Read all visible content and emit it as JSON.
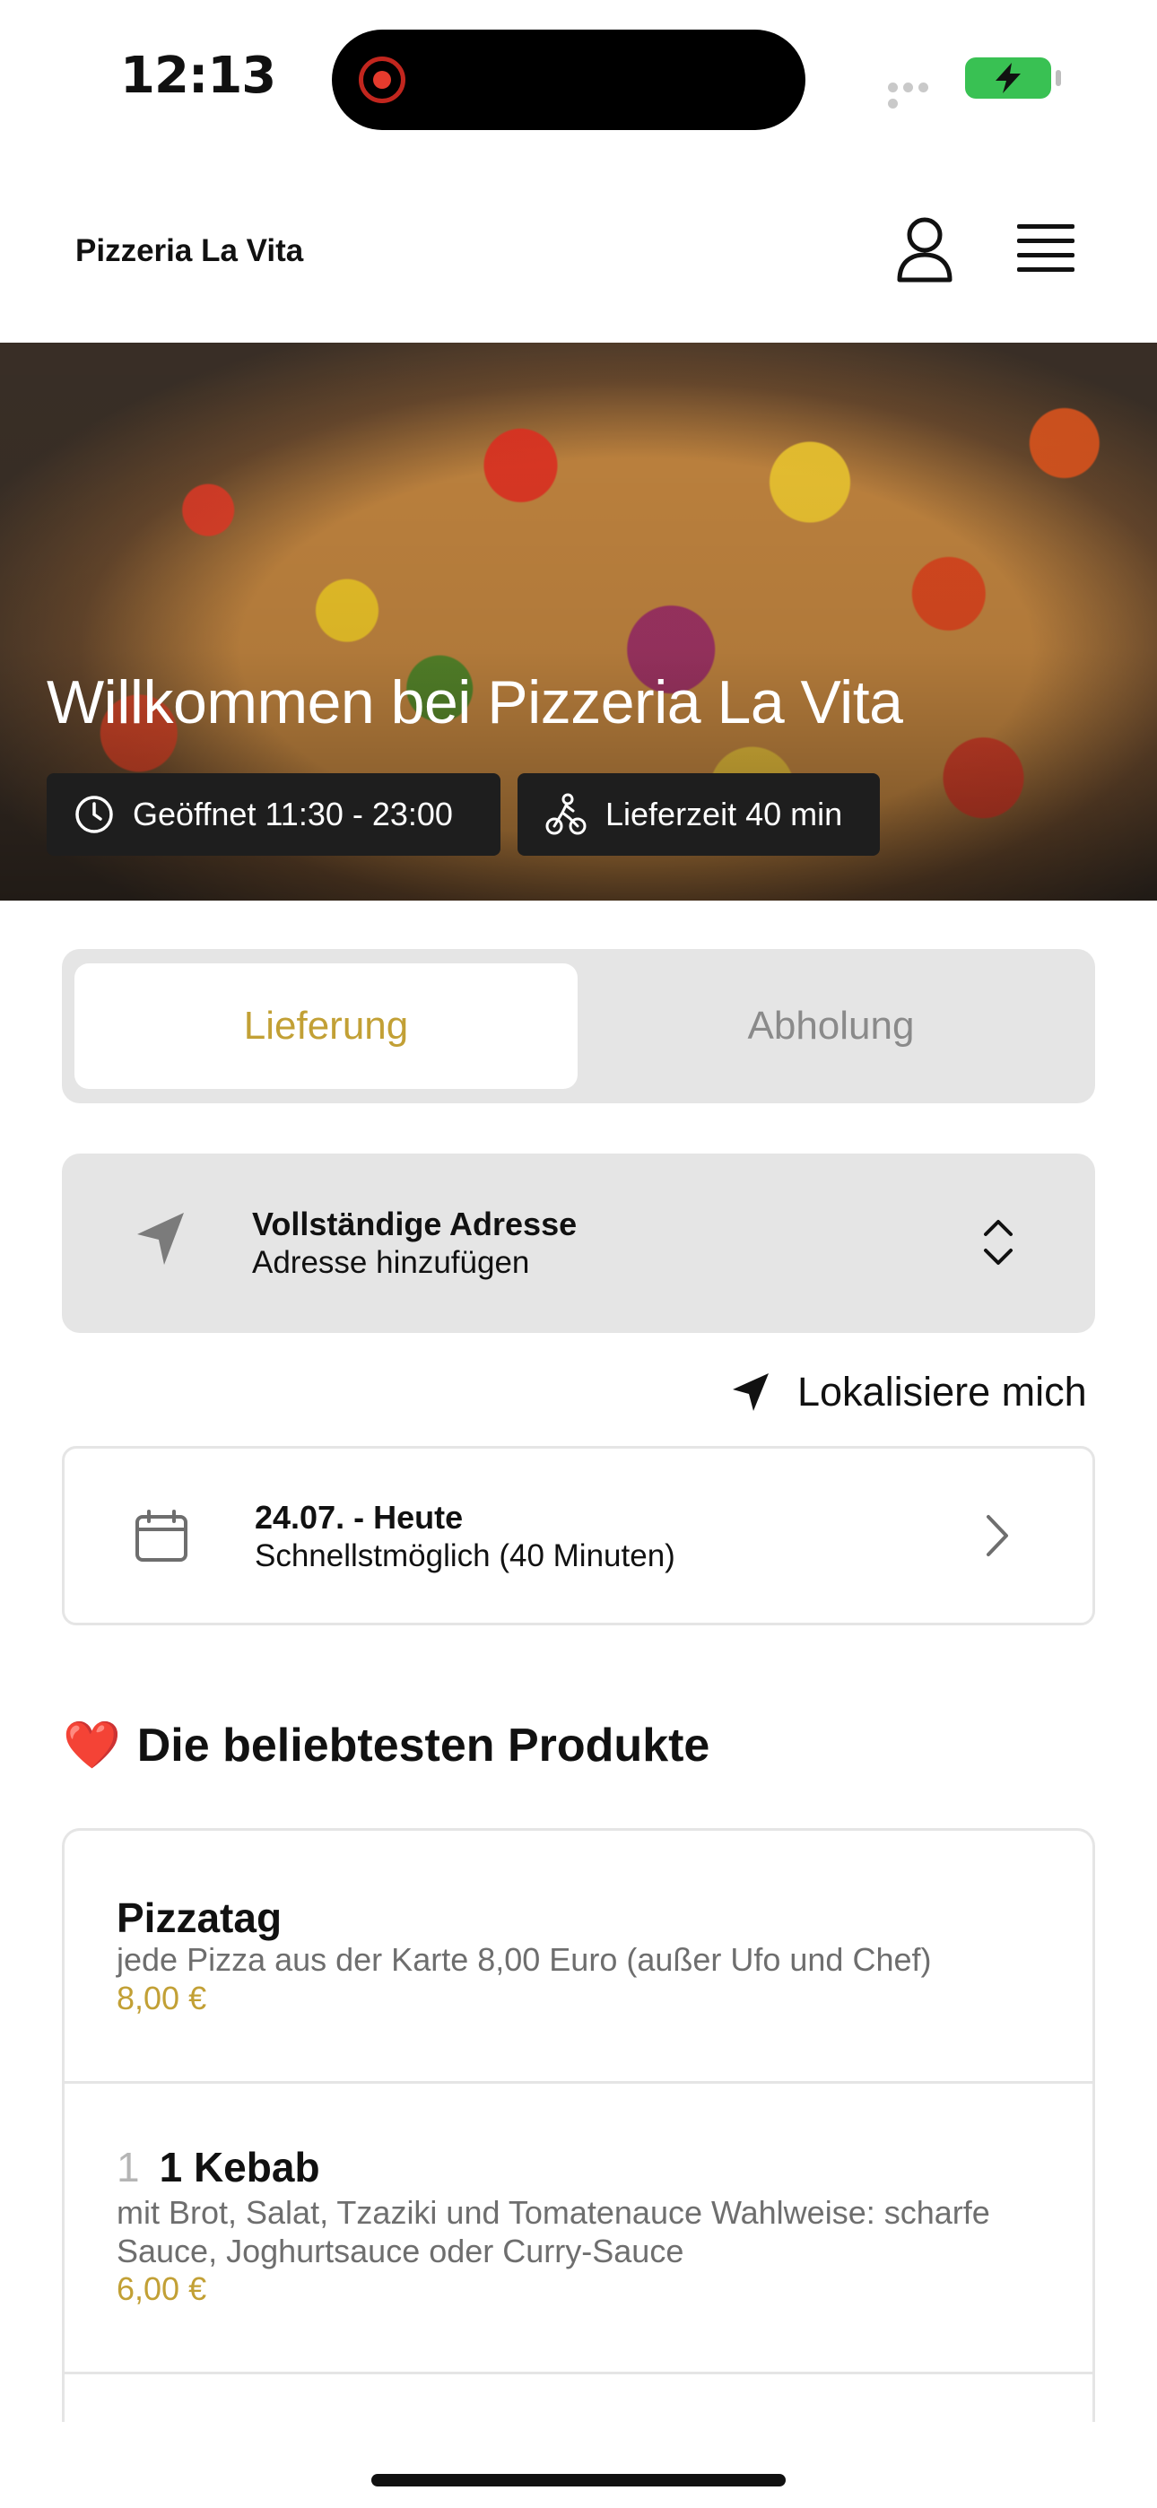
{
  "status_bar": {
    "time": "12:13"
  },
  "header": {
    "title": "Pizzeria La Vita",
    "user_icon": "user-icon",
    "menu_icon": "hamburger-menu-icon"
  },
  "hero": {
    "title": "Willkommen bei Pizzeria La Vita",
    "opening_hours": "Geöffnet 11:30 - 23:00",
    "delivery_time": "Lieferzeit 40 min"
  },
  "mode_toggle": {
    "options": [
      "Lieferung",
      "Abholung"
    ],
    "selected": "Lieferung",
    "accent": "#c2a035"
  },
  "address": {
    "title": "Vollständige Adresse",
    "placeholder": "Adresse hinzufügen"
  },
  "locate": {
    "label": "Lokalisiere mich"
  },
  "date": {
    "title": "24.07. - Heute",
    "subtitle": "Schnellstmöglich (40 Minuten)"
  },
  "popular": {
    "emoji": "❤️",
    "title": "Die beliebtesten Produkte",
    "items": [
      {
        "number": "",
        "name": "Pizzatag",
        "description": "jede Pizza aus der Karte 8,00 Euro (außer Ufo und Chef)",
        "price": "8,00 €"
      },
      {
        "number": "1",
        "name": "1 Kebab",
        "description": "mit Brot, Salat, Tzaziki und Tomatenauce  Wahlweise: scharfe Sauce, Joghurtsauce oder Curry-Sauce",
        "price": "6,00 €"
      }
    ]
  }
}
